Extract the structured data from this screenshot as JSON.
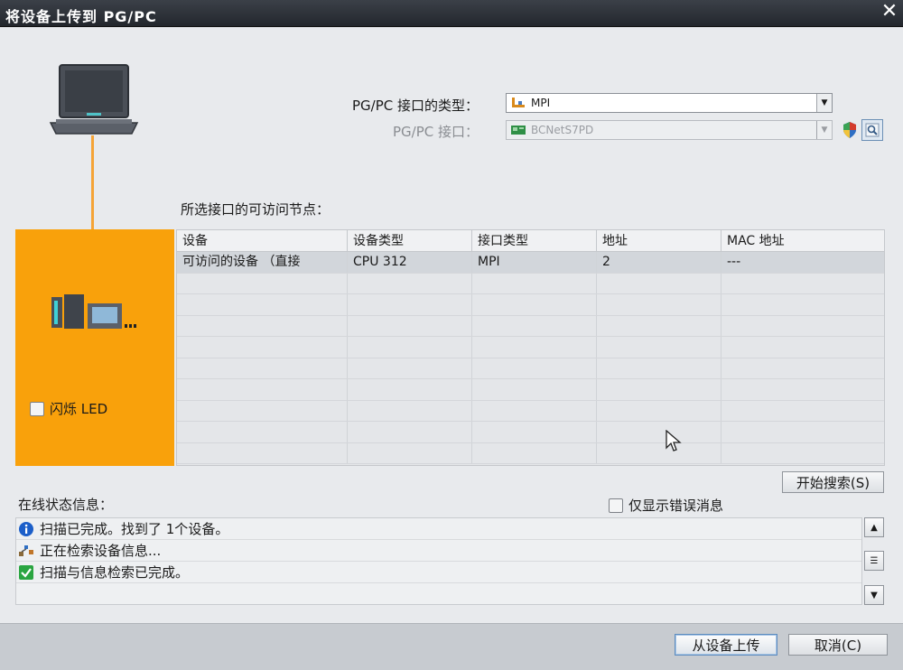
{
  "window": {
    "title": "将设备上传到 PG/PC",
    "close_symbol": "✕"
  },
  "form": {
    "if_type_label": "PG/PC 接口的类型：",
    "if_type_value": "MPI",
    "if_label": "PG/PC 接口：",
    "if_value": "BCNetS7PD"
  },
  "nodes": {
    "section_label": "所选接口的可访问节点：",
    "columns": [
      "设备",
      "设备类型",
      "接口类型",
      "地址",
      "MAC 地址"
    ],
    "rows": [
      [
        "可访问的设备 （直接",
        "CPU 312",
        "MPI",
        "2",
        "---"
      ]
    ]
  },
  "device_panel": {
    "flash_led_label": "闪烁 LED"
  },
  "search": {
    "start_button": "开始搜索(S)"
  },
  "status": {
    "label": "在线状态信息：",
    "only_errors_label": "仅显示错误消息",
    "messages": [
      {
        "icon": "info-icon",
        "text": "扫描已完成。找到了 1个设备。"
      },
      {
        "icon": "network-search-icon",
        "text": "正在检索设备信息..."
      },
      {
        "icon": "check-icon",
        "text": "扫描与信息检索已完成。"
      }
    ]
  },
  "footer": {
    "upload_button": "从设备上传",
    "cancel_button": "取消(C)"
  },
  "colors": {
    "accent_orange": "#f9a10b",
    "link_line": "#f5a437",
    "titlebar": "#2b3037"
  }
}
